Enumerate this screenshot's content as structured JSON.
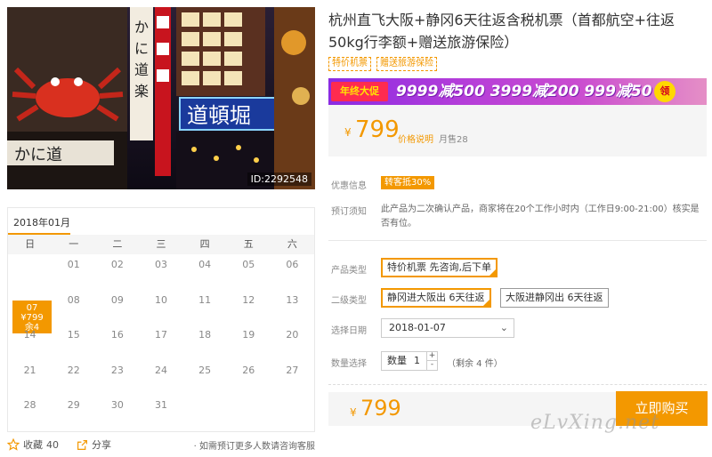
{
  "photo": {
    "id_label": "ID:2292548",
    "sign_text": "道頓堀"
  },
  "calendar": {
    "month": "2018年01月",
    "weekdays": [
      "日",
      "一",
      "二",
      "三",
      "四",
      "五",
      "六"
    ],
    "weeks": [
      [
        "",
        "01",
        "02",
        "03",
        "04",
        "05",
        "06"
      ],
      [
        "07",
        "08",
        "09",
        "10",
        "11",
        "12",
        "13"
      ],
      [
        "14",
        "15",
        "16",
        "17",
        "18",
        "19",
        "20"
      ],
      [
        "21",
        "22",
        "23",
        "24",
        "25",
        "26",
        "27"
      ],
      [
        "28",
        "29",
        "30",
        "31",
        "",
        "",
        ""
      ]
    ],
    "active": {
      "day": "07",
      "price": "¥799",
      "stock": "余4"
    }
  },
  "bottom": {
    "fav_label": "收藏",
    "fav_count": "40",
    "share_label": "分享",
    "consult": "· 如需预订更多人数请咨询客服"
  },
  "product": {
    "title": "杭州直飞大阪+静冈6天往返含税机票（首都航空+往返50kg行李额+赠送旅游保险）",
    "tags": [
      "特价机票",
      "赠送旅游保险"
    ]
  },
  "banner": {
    "badge": "年终大促",
    "text": "9999减500  3999减200  999减50",
    "get": "领"
  },
  "price": {
    "currency": "¥",
    "value": "799",
    "explain": "价格说明",
    "sold": "月售28"
  },
  "info": {
    "promo_label": "优惠信息",
    "promo_badge": "转客抵30%",
    "notice_label": "预订须知",
    "notice_text": "此产品为二次确认产品，商家将在20个工作小时内（工作日9:00-21:00）核实是否有位。"
  },
  "options": {
    "type_label": "产品类型",
    "type_options": [
      "特价机票 先咨询,后下单"
    ],
    "sub_label": "二级类型",
    "sub_options": [
      "静冈进大阪出 6天往返",
      "大阪进静冈出 6天往返"
    ],
    "date_label": "选择日期",
    "date_value": "2018-01-07",
    "qty_label": "数量选择",
    "qty_prefix": "数量",
    "qty_value": "1",
    "remain": "（剩余 4 件）"
  },
  "buy": {
    "currency": "¥",
    "value": "799",
    "button": "立即购买"
  },
  "watermark": "eLvXing.net",
  "colors": {
    "accent": "#f39800",
    "banner": "#b43dd9"
  }
}
